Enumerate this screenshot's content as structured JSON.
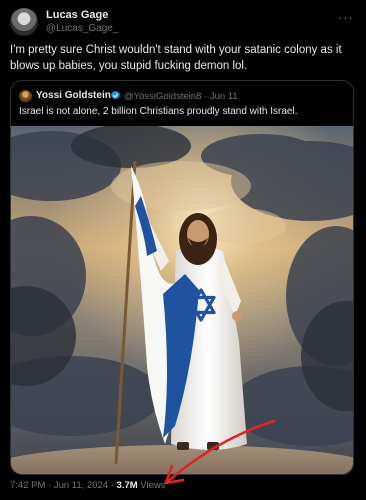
{
  "post": {
    "author_name": "Lucas Gage",
    "author_handle": "@Lucas_Gage_",
    "text": "I'm pretty sure Christ wouldn't stand with your satanic colony as it blows up babies, you stupid fucking demon lol.",
    "time": "7:42 PM",
    "date": "Jun 11, 2024",
    "views_count": "3.7M",
    "views_label": "Views",
    "separator": "·"
  },
  "quoted_post": {
    "author_name": "Yossi Goldstein",
    "author_handle": "@YossiGoldstein8",
    "date": "Jun 11",
    "separator": "·",
    "text": "Israel is not alone, 2 billion Christians proudly stand with Israel."
  },
  "icons": {
    "more": "more-horizontal-icon",
    "verified": "verified-badge-icon"
  },
  "colors": {
    "background": "#000000",
    "text_primary": "#e7e9ea",
    "text_secondary": "#71767b",
    "verified_blue": "#1d9bf0",
    "annotation_red": "#e0242a",
    "border": "#2f3336"
  }
}
